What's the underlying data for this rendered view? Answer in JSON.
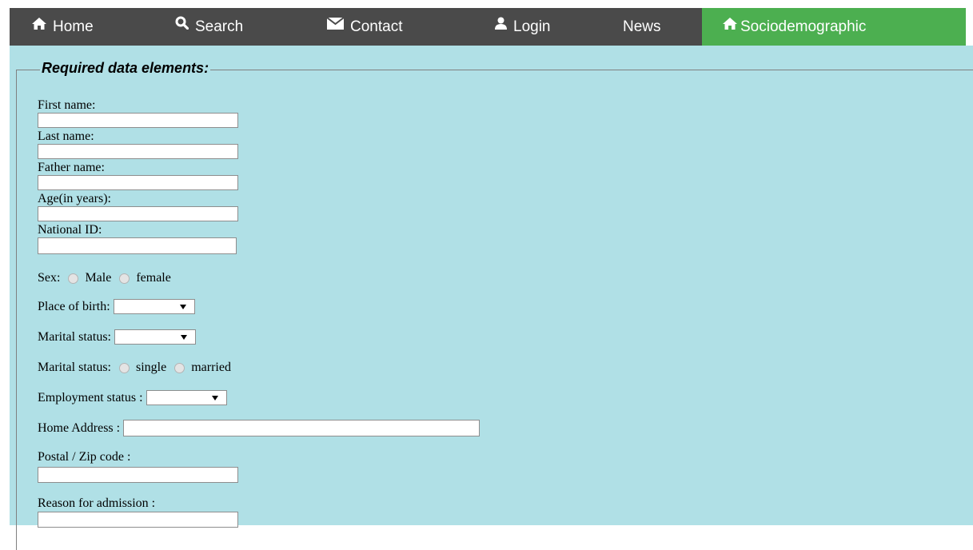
{
  "nav": {
    "items": [
      {
        "label": "Home",
        "icon": "home-icon"
      },
      {
        "label": "Search",
        "icon": "search-icon"
      },
      {
        "label": "Contact",
        "icon": "envelope-icon"
      },
      {
        "label": "Login",
        "icon": "user-icon"
      },
      {
        "label": "News",
        "icon": ""
      },
      {
        "label": "Sociodemographic",
        "icon": "home-icon",
        "active": true
      }
    ],
    "colors": {
      "bar": "#4a4a4a",
      "active": "#4caf50",
      "text": "#ffffff"
    }
  },
  "form": {
    "legend": "Required data elements:",
    "first_name_label": "First name:",
    "first_name_value": "",
    "last_name_label": "Last name:",
    "last_name_value": "",
    "father_name_label": "Father name:",
    "father_name_value": "",
    "age_label": "Age(in years):",
    "age_value": "",
    "national_id_label": "National ID:",
    "national_id_value": "",
    "sex_label": "Sex:",
    "sex_options": [
      "Male",
      "female"
    ],
    "place_of_birth_label": "Place of birth:",
    "place_of_birth_value": "",
    "marital_status_select_label": "Marital status:",
    "marital_status_select_value": "",
    "marital_status_radio_label": "Marital status:",
    "marital_status_options": [
      "single",
      "married"
    ],
    "employment_label": "Employment status :",
    "employment_value": "",
    "home_address_label": "Home Address :",
    "home_address_value": "",
    "postal_label": "Postal / Zip code :",
    "postal_value": "",
    "reason_label": "Reason for admission :",
    "reason_value": ""
  },
  "colors": {
    "background": "#b0e0e6",
    "input_border": "#8e8e8e"
  }
}
